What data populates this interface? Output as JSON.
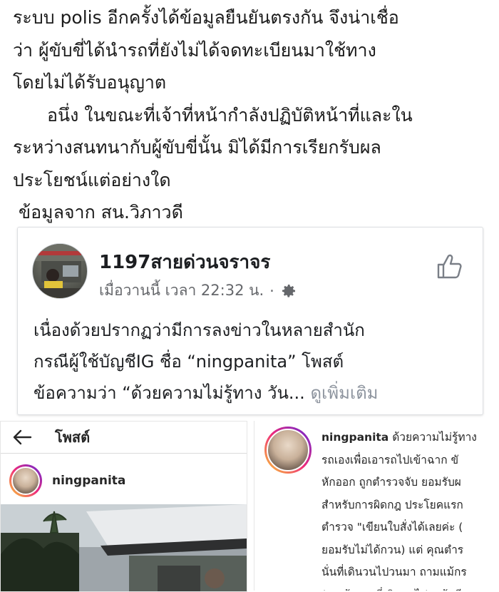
{
  "article": {
    "lines": [
      "ระบบ polis อีกครั้งได้ข้อมูลยืนยันตรงกัน จึงน่าเชื่อ",
      "ว่า ผู้ขับขี่ได้นำรถที่ยังไม่ได้จดทะเบียนมาใช้ทาง",
      "โดยไม่ได้รับอนุญาต",
      "อนึ่ง ในขณะที่เจ้าที่หน้ากำลังปฏิบัติหน้าที่และใน",
      "ระหว่างสนทนากับผู้ขับขี่นั้น มิได้มีการเรียกรับผล",
      "ประโยชน์แต่อย่างใด",
      "ข้อมูลจาก สน.วิภาวดี"
    ]
  },
  "fb_post": {
    "page_name": "1197สายด่วนจราจร",
    "timestamp": "เมื่อวานนี้ เวลา 22:32 น.",
    "separator": "·",
    "icons": {
      "like": "thumbs-up-icon",
      "privacy": "gear-icon"
    },
    "body_lines": [
      "เนื่องด้วยปรากฏว่ามีการลงข่าวในหลายสำนัก",
      "กรณีผู้ใช้บัญชีIG ชื่อ “ningpanita” โพสต์",
      "ข้อความว่า “ด้วยความไม่รู้ทาง วัน..."
    ],
    "see_more": "ดูเพิ่มเติม"
  },
  "ig_post": {
    "header_title": "โพสต์",
    "back_icon": "back-arrow-icon",
    "username": "ningpanita"
  },
  "ig_caption": {
    "username": "ningpanita",
    "first_line": "ด้วยความไม่รู้ทาง",
    "lines": [
      "รถเองเพื่อเอารถไปเข้าฉาก ขั",
      "หักออก ถูกตำรวจจับ ยอมรับผ",
      "สำหรับการผิดกฎ ประโยคแรก",
      "ตำรวจ \"เขียนใบสั่งได้เลยค่ะ (",
      "ยอมรับไม่ได้กวน) แต่ คุณตำร",
      "นั่นที่เดินวนไปวนมา ถามแม้กร",
      "(เออท้ายรถที่เดินวนไปมาก้อมี"
    ]
  },
  "colors": {
    "fb_text": "#1c1e21",
    "fb_meta": "#65676b",
    "see_more": "#8d949e",
    "ig_ring_start": "#f9ce34",
    "ig_ring_end": "#6228d7"
  }
}
